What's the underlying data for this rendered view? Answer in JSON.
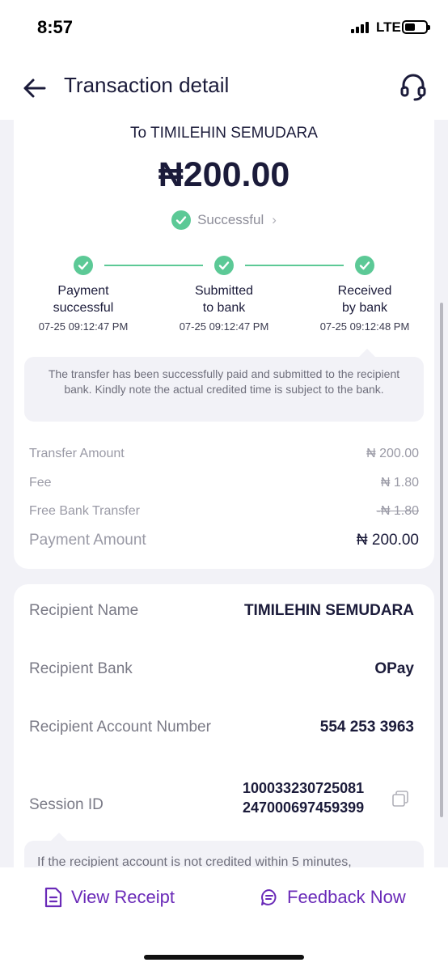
{
  "status_bar": {
    "time": "8:57",
    "network": "LTE"
  },
  "header": {
    "title": "Transaction detail",
    "back_icon": "arrow-left-icon",
    "support_icon": "headset-icon"
  },
  "summary": {
    "recipient_line": "To TIMILEHIN SEMUDARA",
    "amount": "₦200.00",
    "status": "Successful",
    "accent_color": "#5cc996"
  },
  "steps": [
    {
      "label_line1": "Payment",
      "label_line2": "successful",
      "time": "07-25 09:12:47 PM"
    },
    {
      "label_line1": "Submitted",
      "label_line2": "to bank",
      "time": "07-25 09:12:47 PM"
    },
    {
      "label_line1": "Received",
      "label_line2": "by bank",
      "time": "07-25 09:12:48 PM"
    }
  ],
  "info_message": "The transfer has been successfully paid and submitted to the recipient bank. Kindly note the actual credited time is subject to the bank.",
  "fees": {
    "transfer_amount": {
      "label": "Transfer Amount",
      "value": "₦ 200.00"
    },
    "fee": {
      "label": "Fee",
      "value": "₦ 1.80"
    },
    "free_bank_transfer": {
      "label": "Free Bank Transfer",
      "value": "-₦ 1.80"
    },
    "payment_amount": {
      "label": "Payment Amount",
      "value": "₦ 200.00"
    }
  },
  "details": {
    "recipient_name": {
      "label": "Recipient Name",
      "value": "TIMILEHIN SEMUDARA"
    },
    "recipient_bank": {
      "label": "Recipient Bank",
      "value": "OPay"
    },
    "account_number": {
      "label": "Recipient Account Number",
      "value": "554 253 3963"
    },
    "session_id": {
      "label": "Session ID",
      "value_line1": "100033230725081",
      "value_line2": "247000697459399"
    }
  },
  "notice": "If the recipient account is not credited within 5 minutes,",
  "bottom": {
    "view_receipt": "View Receipt",
    "feedback": "Feedback Now",
    "brand_color": "#6a2ab8"
  }
}
